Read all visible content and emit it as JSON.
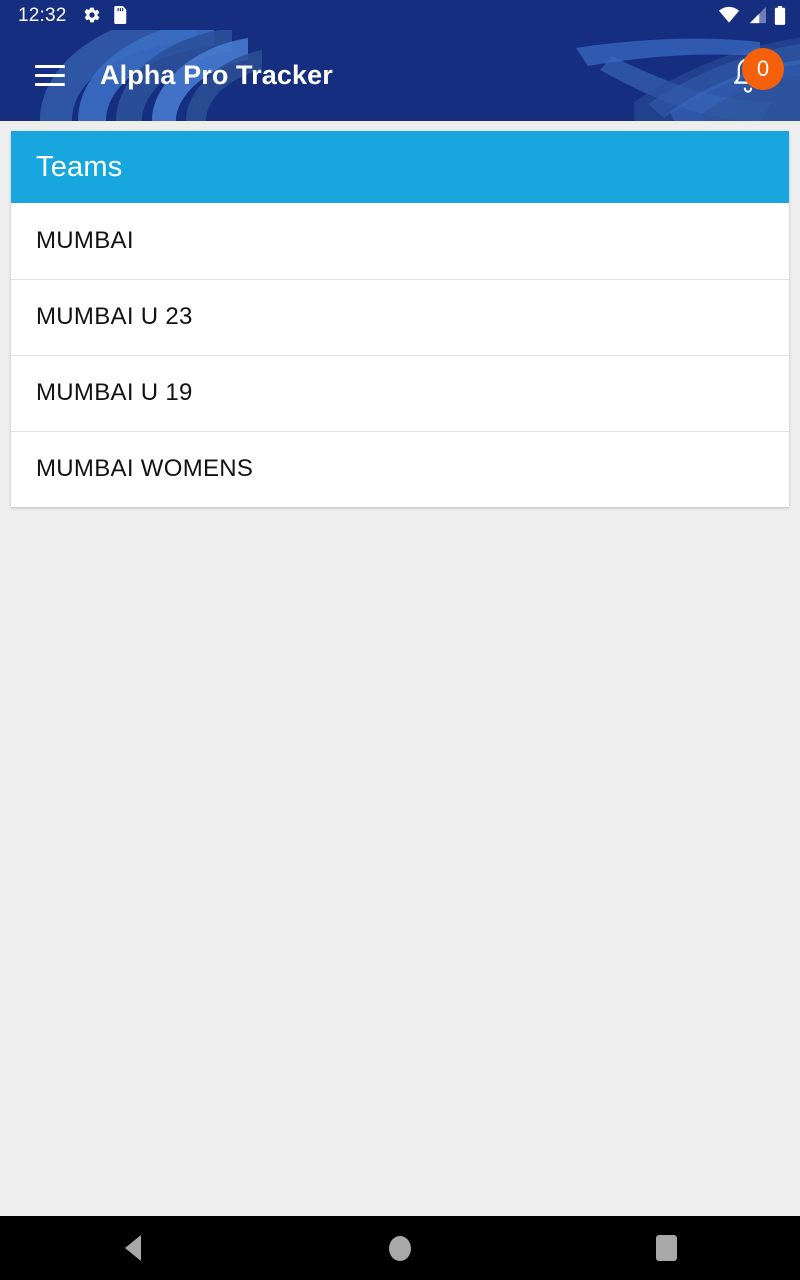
{
  "status_bar": {
    "clock": "12:32",
    "icons_left": [
      "gear-icon",
      "sd-card-icon"
    ],
    "icons_right": [
      "wifi-icon",
      "cellular-signal-icon",
      "battery-icon"
    ],
    "background_color": "#152E7F"
  },
  "app_bar": {
    "title": "Alpha Pro Tracker",
    "menu_icon": "hamburger-menu-icon",
    "notification_icon": "bell-icon",
    "notification_count": "0",
    "badge_color": "#F4610A",
    "background_color": "#152E7F"
  },
  "card": {
    "header": {
      "title": "Teams",
      "background_color": "#17A7DE"
    },
    "teams": [
      {
        "name": "MUMBAI"
      },
      {
        "name": "MUMBAI U 23"
      },
      {
        "name": "MUMBAI U 19"
      },
      {
        "name": "MUMBAI WOMENS"
      }
    ]
  },
  "nav_bar": {
    "back_label": "Back",
    "home_label": "Home",
    "recents_label": "Recents",
    "background_color": "#000000"
  }
}
